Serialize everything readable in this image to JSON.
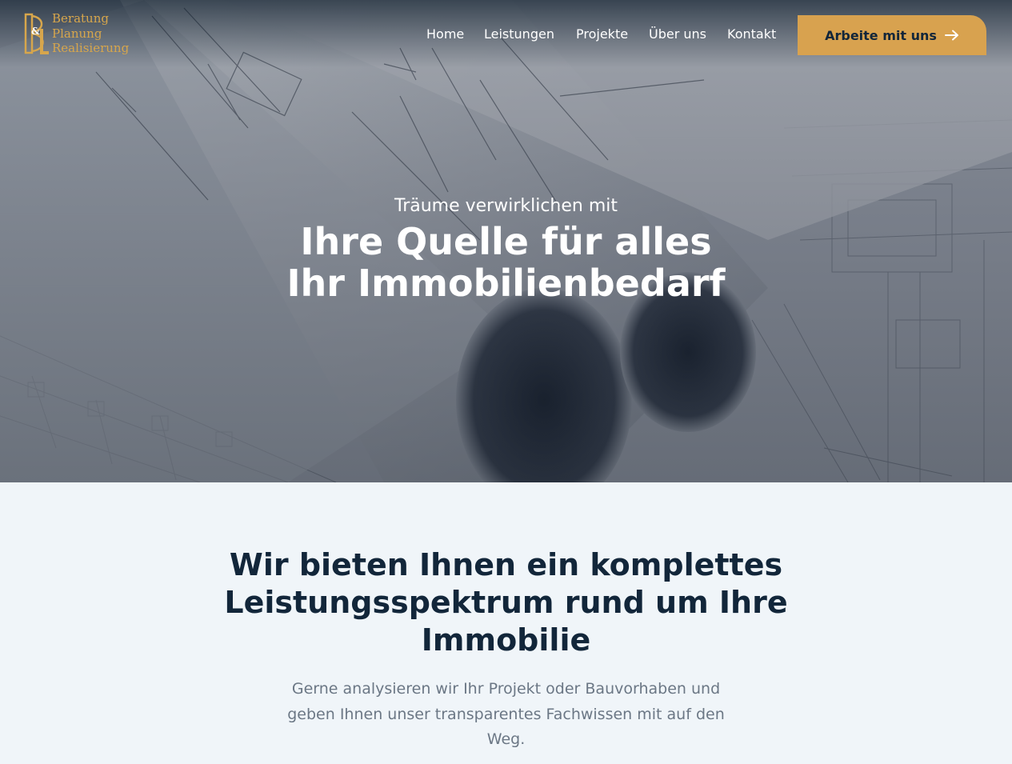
{
  "brand": {
    "logo_lines": [
      "Beratung",
      "Planung",
      "Realisierung"
    ],
    "accent_color": "#d8a24f"
  },
  "nav": {
    "items": [
      "Home",
      "Leistungen",
      "Projekte",
      "Über uns",
      "Kontakt"
    ],
    "cta_label": "Arbeite mit uns",
    "cta_icon": "arrow-right-icon"
  },
  "hero": {
    "subtitle": "Träume verwirklichen mit",
    "title_line1": "Ihre Quelle für alles",
    "title_line2": "Ihr Immobilienbedarf"
  },
  "services": {
    "title": "Wir bieten Ihnen ein komplettes Leistungsspektrum rund um Ihre Immobilie",
    "text": "Gerne analysieren wir Ihr Projekt oder Bauvorhaben und geben Ihnen unser transparentes Fachwissen mit auf den Weg."
  }
}
